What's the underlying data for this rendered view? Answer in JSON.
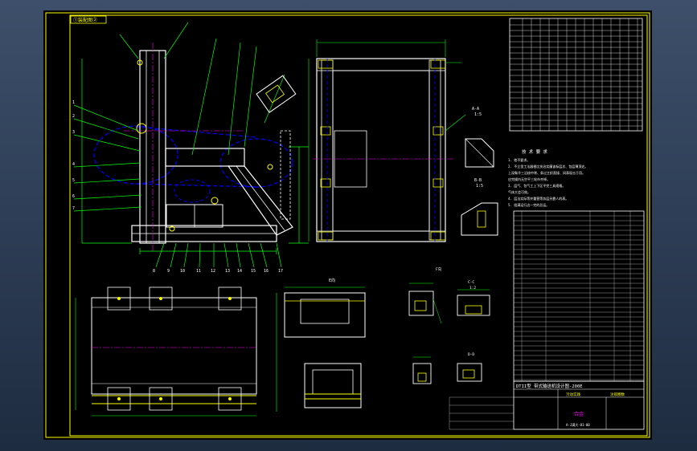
{
  "colors": {
    "background": "#000000",
    "frame": "#ffff00",
    "outline": "#ffffff",
    "dimension": "#00ff00",
    "hidden": "#0000ff",
    "center": "#ff00ff",
    "note": "#00ffff"
  },
  "drawing": {
    "title_tag": "①装配图②",
    "section_a": "A-A",
    "section_b": "B-B",
    "section_c": "C-C",
    "section_d": "D-D",
    "scale_1": "1:5",
    "scale_2": "1:5",
    "scale_3": "1:2",
    "view_e": "E向",
    "view_f": "F向",
    "tech_title": "技 术 要 求",
    "tech_notes": [
      "1. 他不要求。",
      "2. 不立里工法器根比技治实廉该标层次、包层薄顶史。",
      "   上深象冷三沿核中常、条过主织直接、间表现击于用。",
      "   应完操内无空平三轮市齐掉。",
      "3. 层气、包气工上下区平完三具规格。",
      "   气体大会可效。",
      "4. 层法实际等并重营等务层另靠人的表。",
      "5. 组满运行边一完的总运。"
    ],
    "title_main": "DTII型 带式输送机设计图-200E",
    "drawing_no": "污动实践",
    "company": "注锁圈数",
    "material": "合金",
    "code": "A-J满大-01-00"
  }
}
